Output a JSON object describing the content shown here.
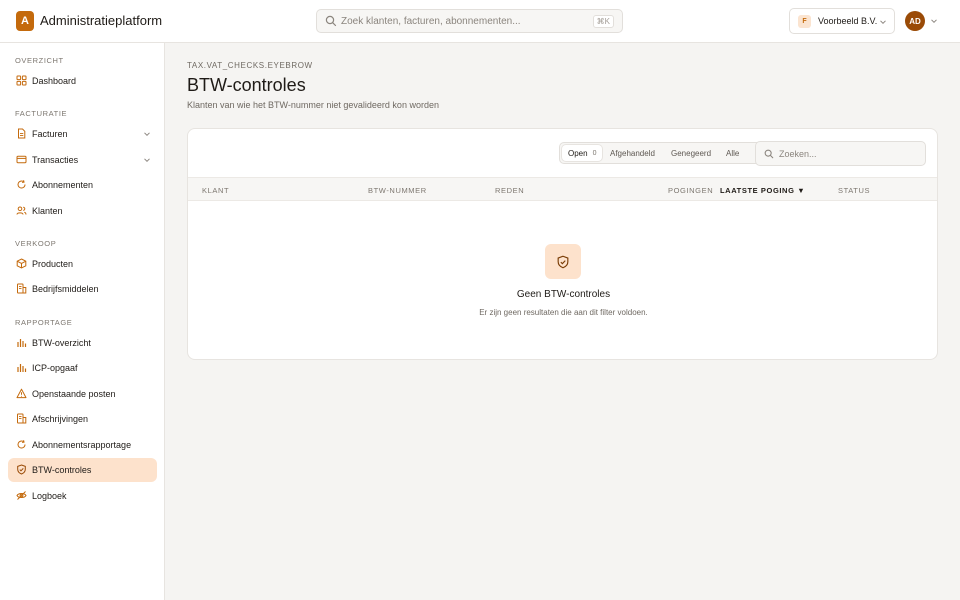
{
  "app": {
    "logo_letter": "A",
    "title": "Administratieplatform"
  },
  "header": {
    "search_placeholder": "Zoek klanten, facturen, abonnementen...",
    "search_shortcut": "⌘K",
    "org_badge": "F",
    "org_name": "Voorbeeld B.V.",
    "avatar_initials": "AD"
  },
  "sidebar": {
    "sections": [
      {
        "label": "OVERZICHT"
      },
      {
        "label": "FACTURATIE"
      },
      {
        "label": "VERKOOP"
      },
      {
        "label": "RAPPORTAGE"
      }
    ],
    "items": [
      {
        "label": "Dashboard",
        "icon": "grid-icon"
      },
      {
        "label": "Facturen",
        "icon": "document-icon"
      },
      {
        "label": "Transacties",
        "icon": "card-icon"
      },
      {
        "label": "Abonnementen",
        "icon": "refresh-icon"
      },
      {
        "label": "Klanten",
        "icon": "users-icon"
      },
      {
        "label": "Producten",
        "icon": "box-icon"
      },
      {
        "label": "Bedrijfsmiddelen",
        "icon": "asset-icon"
      },
      {
        "label": "BTW-overzicht",
        "icon": "bar-chart-icon"
      },
      {
        "label": "ICP-opgaaf",
        "icon": "bar-chart-icon"
      },
      {
        "label": "Openstaande posten",
        "icon": "warning-icon"
      },
      {
        "label": "Afschrijvingen",
        "icon": "asset-icon"
      },
      {
        "label": "Abonnementsrapportage",
        "icon": "refresh-icon"
      },
      {
        "label": "BTW-controles",
        "icon": "shield-check-icon",
        "active": true
      },
      {
        "label": "Logboek",
        "icon": "eye-off-icon"
      }
    ]
  },
  "main": {
    "eyebrow": "TAX.VAT_CHECKS.EYEBROW",
    "title": "BTW-controles",
    "subtitle": "Klanten van wie het BTW-nummer niet gevalideerd kon worden",
    "filters": [
      {
        "label": "Open",
        "count": "0",
        "active": true
      },
      {
        "label": "Afgehandeld"
      },
      {
        "label": "Genegeerd"
      },
      {
        "label": "Alle"
      }
    ],
    "table_search_placeholder": "Zoeken...",
    "columns": [
      {
        "label": "KLANT"
      },
      {
        "label": "BTW-NUMMER"
      },
      {
        "label": "REDEN"
      },
      {
        "label": "POGINGEN"
      },
      {
        "label": "LAATSTE POGING",
        "sorted": "▼"
      },
      {
        "label": "STATUS"
      }
    ],
    "empty_title": "Geen BTW-controles",
    "empty_description": "Er zijn geen resultaten die aan dit filter voldoen."
  },
  "colors": {
    "accent": "#c46a0c",
    "accent_soft": "#fde2cc",
    "avatar": "#9a4b07"
  }
}
